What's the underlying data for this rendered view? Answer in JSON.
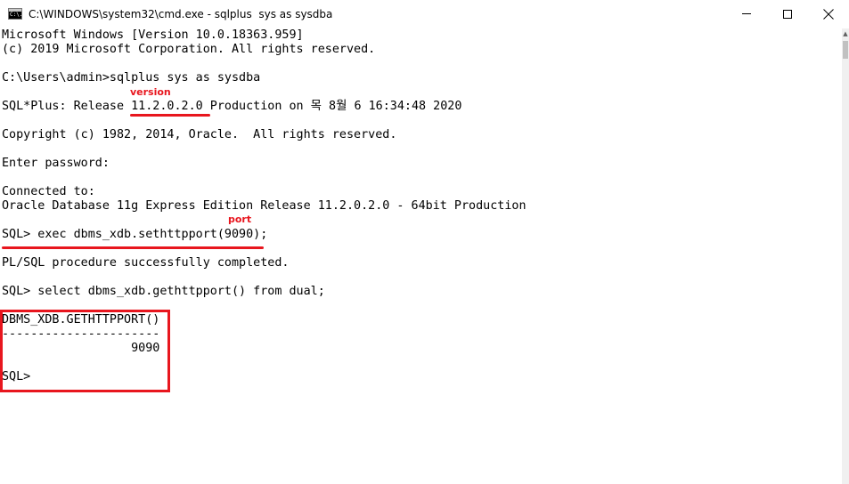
{
  "window": {
    "title": "C:\\WINDOWS\\system32\\cmd.exe - sqlplus  sys as sysdba",
    "icon_label": "C:\\."
  },
  "console": {
    "lines": [
      "Microsoft Windows [Version 10.0.18363.959]",
      "(c) 2019 Microsoft Corporation. All rights reserved.",
      "",
      "C:\\Users\\admin>sqlplus sys as sysdba",
      "",
      "SQL*Plus: Release 11.2.0.2.0 Production on 목 8월 6 16:34:48 2020",
      "",
      "Copyright (c) 1982, 2014, Oracle.  All rights reserved.",
      "",
      "Enter password:",
      "",
      "Connected to:",
      "Oracle Database 11g Express Edition Release 11.2.0.2.0 - 64bit Production",
      "",
      "SQL> exec dbms_xdb.sethttpport(9090);",
      "",
      "PL/SQL procedure successfully completed.",
      "",
      "SQL> select dbms_xdb.gethttpport() from dual;",
      "",
      "DBMS_XDB.GETHTTPPORT()",
      "----------------------",
      "                  9090",
      "",
      "SQL>"
    ]
  },
  "annotations": {
    "version_label": "version",
    "port_label": "port",
    "color": "#e8161e"
  },
  "icons": {
    "minimize": "minimize-icon",
    "maximize": "maximize-icon",
    "close": "close-icon",
    "app": "cmd-app-icon"
  }
}
